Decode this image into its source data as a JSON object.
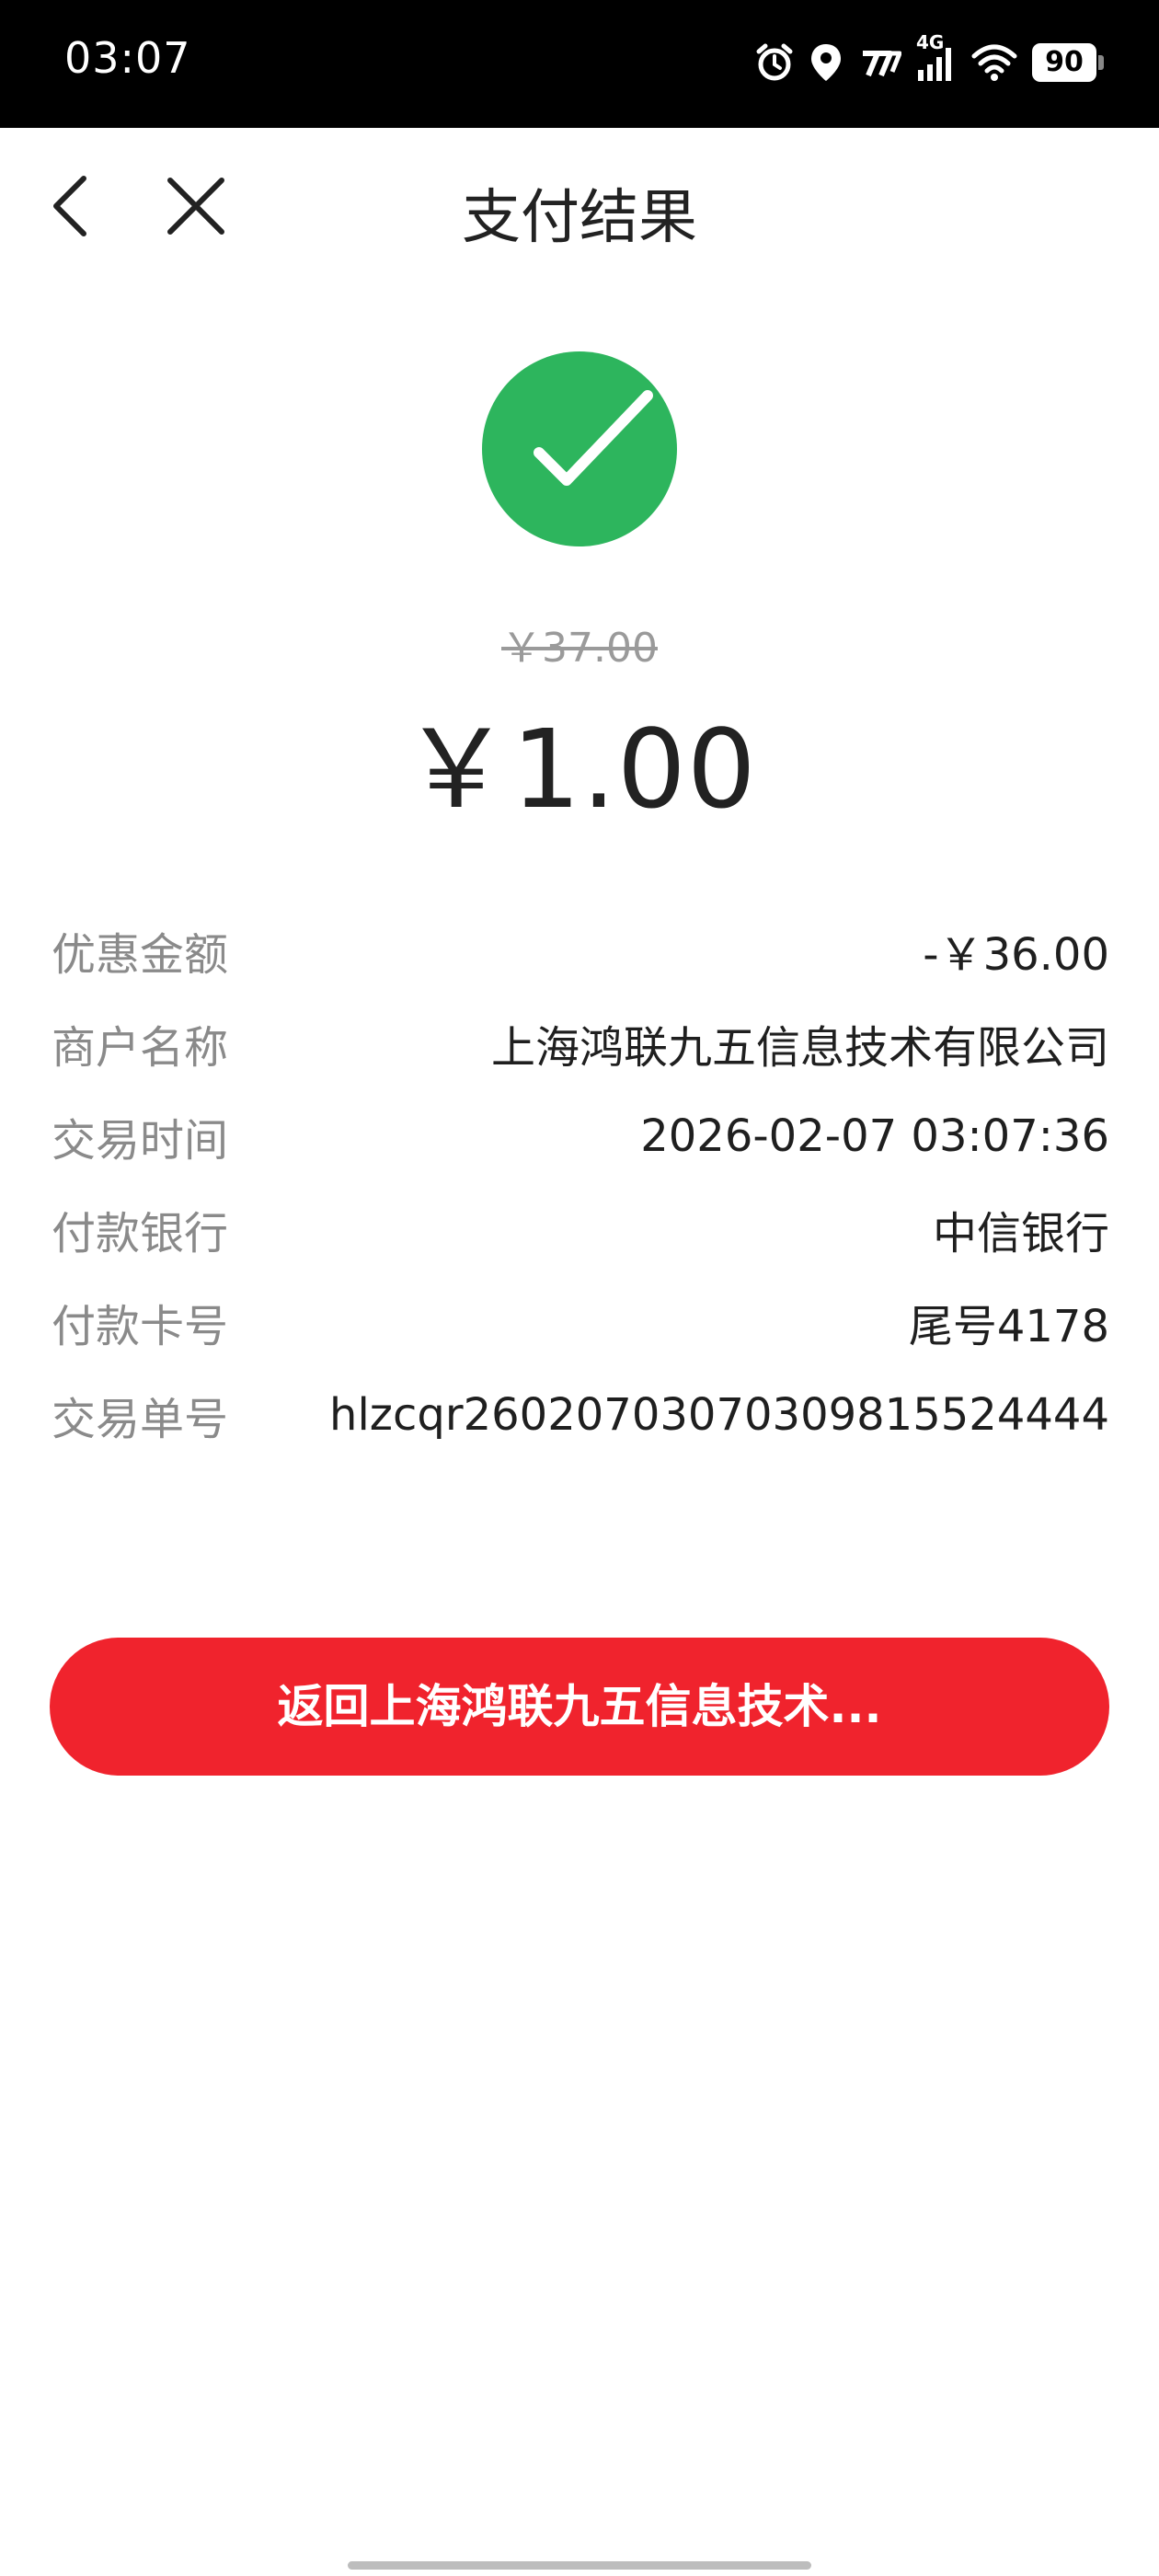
{
  "status_bar": {
    "time": "03:07",
    "network_label": "4G",
    "battery": "90",
    "icons": [
      "alarm-icon",
      "location-icon",
      "network-speed-icon",
      "cellular-signal-icon",
      "wifi-icon",
      "battery-icon"
    ]
  },
  "nav": {
    "title": "支付结果",
    "back_icon": "chevron-left-icon",
    "close_icon": "close-icon"
  },
  "result": {
    "status_icon": "check-circle-icon",
    "status_color": "#2db55d",
    "original_price": "￥37.00",
    "paid_amount": "￥1.00"
  },
  "details": [
    {
      "label": "优惠金额",
      "value": "-￥36.00"
    },
    {
      "label": "商户名称",
      "value": "上海鸿联九五信息技术有限公司"
    },
    {
      "label": "交易时间",
      "value": "2026-02-07 03:07:36"
    },
    {
      "label": "付款银行",
      "value": "中信银行"
    },
    {
      "label": "付款卡号",
      "value": "尾号4178"
    },
    {
      "label": "交易单号",
      "value": "hlzcqr26020703070309815524444"
    }
  ],
  "actions": {
    "return_label": "返回上海鸿联九五信息技术...",
    "return_color": "#f0232d"
  }
}
